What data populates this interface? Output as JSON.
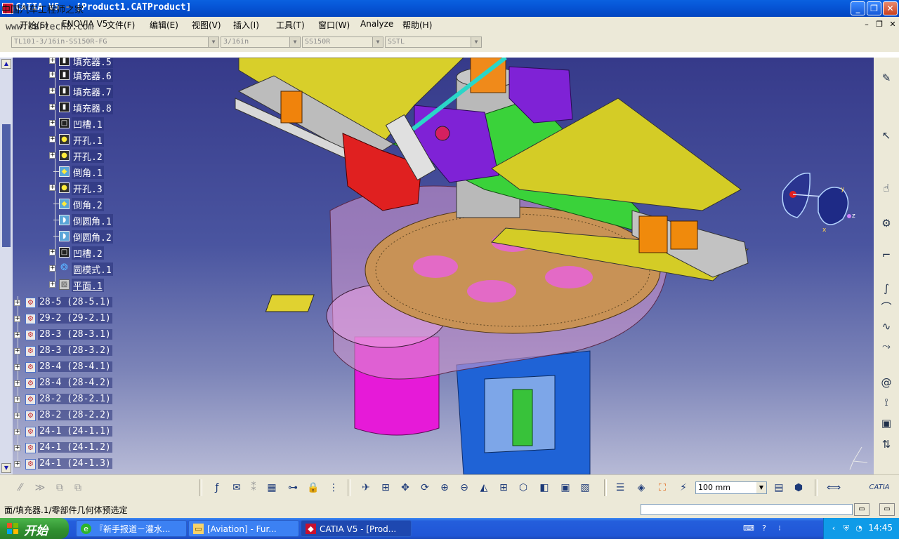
{
  "window": {
    "title": "CATIA V5 - [Product1.CATProduct]"
  },
  "watermark": {
    "line1": "中国汽车工程师之家",
    "line2": "www.cartech8.com"
  },
  "menu": {
    "items": [
      "开始(S)",
      "ENOVIA V5",
      "文件(F)",
      "编辑(E)",
      "视图(V)",
      "插入(I)",
      "工具(T)",
      "窗口(W)",
      "Analyze",
      "帮助(H)"
    ]
  },
  "combos": [
    "TL101-3/16in-SS150R-FG",
    "3/16in",
    "SS150R",
    "SSTL"
  ],
  "tree": {
    "features": [
      {
        "label": "填充器.5",
        "icon": "pad-icon"
      },
      {
        "label": "填充器.6",
        "icon": "pad-icon"
      },
      {
        "label": "填充器.7",
        "icon": "pad-icon"
      },
      {
        "label": "填充器.8",
        "icon": "pad-icon"
      },
      {
        "label": "凹槽.1",
        "icon": "pocket-icon"
      },
      {
        "label": "开孔.1",
        "icon": "hole-icon"
      },
      {
        "label": "开孔.2",
        "icon": "hole-icon"
      },
      {
        "label": "倒角.1",
        "icon": "chamfer-icon"
      },
      {
        "label": "开孔.3",
        "icon": "hole-icon"
      },
      {
        "label": "倒角.2",
        "icon": "chamfer-icon"
      },
      {
        "label": "倒圆角.1",
        "icon": "fillet-icon"
      },
      {
        "label": "倒圆角.2",
        "icon": "fillet-icon"
      },
      {
        "label": "凹槽.2",
        "icon": "pocket-icon"
      },
      {
        "label": "圆模式.1",
        "icon": "circular-pattern-icon"
      },
      {
        "label": "平面.1",
        "icon": "plane-icon"
      }
    ],
    "products": [
      "28-5 (28-5.1)",
      "29-2 (29-2.1)",
      "28-3 (28-3.1)",
      "28-3 (28-3.2)",
      "28-4 (28-4.1)",
      "28-4 (28-4.2)",
      "28-2 (28-2.1)",
      "28-2 (28-2.2)",
      "24-1 (24-1.1)",
      "24-1 (24-1.2)",
      "24-1 (24-1.3)"
    ]
  },
  "compass": {
    "axis_y": "y",
    "axis_z": "z",
    "axis_x": "x"
  },
  "zoom": {
    "value": "100 mm"
  },
  "status": {
    "text": "面/填充器.1/零部件几何体预选定"
  },
  "taskbar": {
    "start_label": "开始",
    "tasks": [
      "『新手报道－灌水...",
      "[Aviation] - Fur...",
      "CATIA V5 - [Prod..."
    ],
    "clock": "14:45"
  },
  "brand": {
    "logo_text": "CATIA"
  }
}
